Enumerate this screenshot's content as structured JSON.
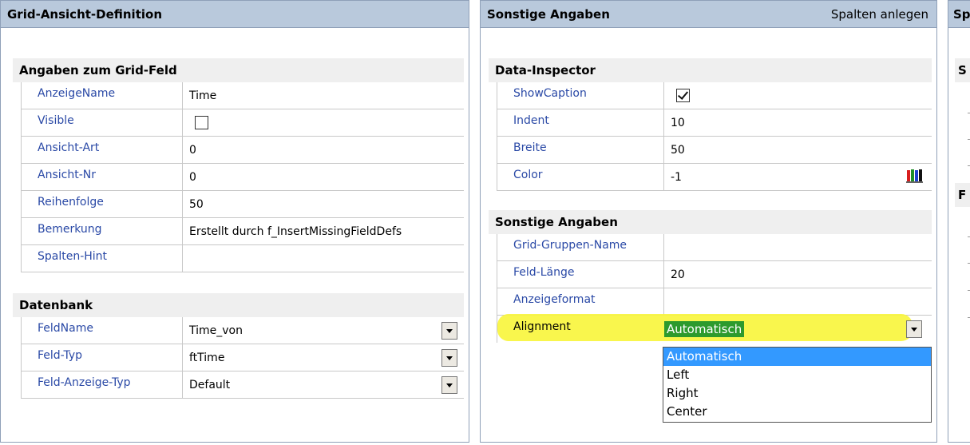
{
  "panel1": {
    "title": "Grid-Ansicht-Definition",
    "section1": {
      "title": "Angaben zum Grid-Feld",
      "rows": [
        {
          "label": "AnzeigeName",
          "value": "Time"
        },
        {
          "label": "Visible",
          "checked": false
        },
        {
          "label": "Ansicht-Art",
          "value": "0"
        },
        {
          "label": "Ansicht-Nr",
          "value": "0"
        },
        {
          "label": "Reihenfolge",
          "value": "50"
        },
        {
          "label": "Bemerkung",
          "value": "Erstellt durch f_InsertMissingFieldDefs"
        },
        {
          "label": "Spalten-Hint",
          "value": ""
        }
      ]
    },
    "section2": {
      "title": "Datenbank",
      "rows": [
        {
          "label": "FeldName",
          "value": "Time_von"
        },
        {
          "label": "Feld-Typ",
          "value": "ftTime"
        },
        {
          "label": "Feld-Anzeige-Typ",
          "value": "Default"
        }
      ]
    }
  },
  "panel2": {
    "title": "Sonstige Angaben",
    "action": "Spalten anlegen",
    "section1": {
      "title": "Data-Inspector",
      "rows": [
        {
          "label": "ShowCaption",
          "checked": true
        },
        {
          "label": "Indent",
          "value": "10"
        },
        {
          "label": "Breite",
          "value": "50"
        },
        {
          "label": "Color",
          "value": "-1",
          "icon": "color-pencils-icon"
        }
      ]
    },
    "section2": {
      "title": "Sonstige Angaben",
      "rows": [
        {
          "label": "Grid-Gruppen-Name",
          "value": ""
        },
        {
          "label": "Feld-Länge",
          "value": "20"
        },
        {
          "label": "Anzeigeformat",
          "value": ""
        },
        {
          "label": "Alignment",
          "value": "Automatisch"
        }
      ]
    },
    "dropdown_options": [
      "Automatisch",
      "Left",
      "Right",
      "Center"
    ],
    "dropdown_selected": "Automatisch"
  },
  "panel3": {
    "title_partial": "Sp",
    "section1_partial": "S",
    "section2_partial": "F"
  },
  "colors": {
    "header_bg": "#b9c9dc",
    "label_text": "#2a49a6",
    "highlight": "#f8f53a",
    "selected_option": "#3399ff",
    "selected_value_bg": "#2d9a2d"
  }
}
